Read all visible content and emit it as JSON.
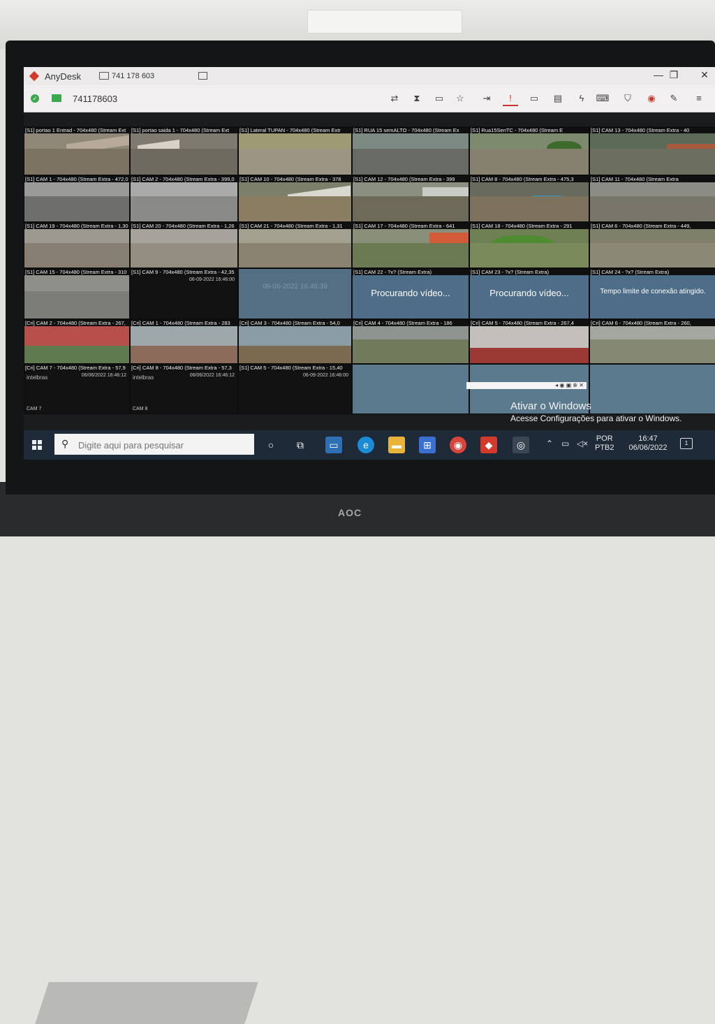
{
  "anydesk": {
    "app_name": "AnyDesk",
    "tab_id": "741 178 603",
    "session_id": "741178603",
    "window_controls": {
      "minimize": "—",
      "maximize": "❐",
      "close": "✕"
    }
  },
  "toolbar_tools": [
    {
      "icon": "transfer-icon",
      "glyph": "⇄"
    },
    {
      "icon": "hourglass-icon",
      "glyph": "⧗"
    },
    {
      "icon": "chat-icon",
      "glyph": "▭"
    },
    {
      "icon": "star-icon",
      "glyph": "☆"
    },
    {
      "icon": "switch-icon",
      "glyph": "⇥"
    },
    {
      "icon": "actions-icon",
      "glyph": "!"
    },
    {
      "icon": "display-icon",
      "glyph": "▭"
    },
    {
      "icon": "message-icon",
      "glyph": "▤"
    },
    {
      "icon": "lightning-icon",
      "glyph": "ϟ"
    },
    {
      "icon": "keyboard-icon",
      "glyph": "⌨"
    },
    {
      "icon": "shield-icon",
      "glyph": "⛉"
    },
    {
      "icon": "record-icon",
      "glyph": "◉"
    },
    {
      "icon": "pen-icon",
      "glyph": "✎"
    },
    {
      "icon": "menu-icon",
      "glyph": "≡"
    }
  ],
  "cameras": {
    "portao1": "[S1] portao 1 Entrad - 704x480 (Stream Ext",
    "portao_saida": "[S1] portao saida 1 - 704x480 (Stream Ext",
    "lateral": "[S1] Lateral TUPAN - 704x480 (Stream Extr",
    "rua15": "[S1] RUA 15 semALTO - 704x480 (Stream Ex",
    "rua15sen": "[S1] Rua15SenTC - 704x480 (Stream E",
    "cam13": "[S1] CAM 13 - 704x480 (Stream Extra - 40",
    "cam1": "[S1] CAM 1 - 704x480 (Stream Extra - 472,0",
    "cam2": "[S1] CAM 2 - 704x480 (Stream Extra - 399,0",
    "cam10": "[S1] CAM 10 - 704x480 (Stream Extra - 378",
    "cam12": "[S1] CAM 12 - 704x480 (Stream Extra - 399",
    "cam8": "[S1] CAM 8 - 704x480 (Stream Extra - 475,3",
    "cam11": "[S1] CAM 11 - 704x480 (Stream Extra",
    "cam19": "[S1] CAM 19 - 704x480 (Stream Extra - 1,30",
    "cam20": "[S1] CAM 20 - 704x480 (Stream Extra - 1,26",
    "cam21": "[S1] CAM 21 - 704x480 (Stream Extra - 1,31",
    "cam17": "[S1] CAM 17 - 704x480 (Stream Extra - 641",
    "cam18": "[S1] CAM 18 - 704x480 (Stream Extra - 291",
    "cam6": "[S1] CAM 6 - 704x480 (Stream Extra - 449,",
    "cam15": "[S1] CAM 15 - 704x480 (Stream Extra - 310",
    "cam9": "[S1] CAM 9 - 704x480 (Stream Extra - 42,35",
    "cam22": "[S1] CAM 22 - ?x? (Stream Extra)",
    "cam23": "[S1] CAM 23 - ?x? (Stream Extra)",
    "cam24": "[S1] CAM 24 - ?x? (Stream Extra)",
    "cri_cam2": "[Cri] CAM 2 - 704x480 (Stream Extra - 267,",
    "cri_cam1": "[Cri] CAM 1 - 704x480 (Stream Extra - 283",
    "cri_cam3": "[Cri] CAM 3 - 704x480 (Stream Extra - 54,0",
    "cri_cam4": "[Cri] CAM 4 - 704x480 (Stream Extra - 186",
    "cri_cam5": "[Cri] CAM 5 - 704x480 (Stream Extra - 267,4",
    "cri_cam6": "[Cri] CAM 6 - 704x480 (Stream Extra - 260,",
    "cri_cam7": "[Cri] CAM 7 - 704x480 (Stream Extra - 57,9",
    "cri_cam8": "[Cri] CAM 8 - 704x480 (Stream Extra - 57,3",
    "cri_cam5b": "[S1] CAM 5 - 704x480 (Stream Extra - 15,40"
  },
  "messages": {
    "searching_video": "Procurando vídeo...",
    "timeout": "Tempo limite de conexão atingido."
  },
  "overlays": {
    "intelbras": "intelbras",
    "stamp_cam9": "06-09-2022 16:46:00",
    "stamp_cam7": "06/06/2022 16:46:12",
    "stamp_cam8": "06/06/2022 16:46:12",
    "stamp_cam5b": "06-09-2022 16:46:00",
    "cam_label_7": "CAM 7",
    "cam_label_8": "CAM 8",
    "ghost_date": "06-06-2022 16:46:39"
  },
  "activation": {
    "title": "Ativar o Windows",
    "subtitle": "Acesse Configurações para ativar o Windows."
  },
  "taskbar": {
    "search_placeholder": "Digite aqui para pesquisar",
    "lang_top": "POR",
    "lang_bottom": "PTB2",
    "time": "16:47",
    "date": "06/06/2022",
    "notification_count": "1"
  },
  "monitor_brand": "AOC"
}
